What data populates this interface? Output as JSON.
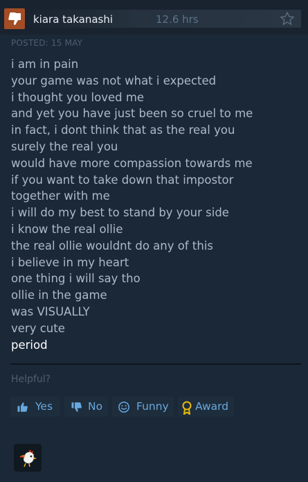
{
  "review": {
    "username": "kiara takanashi",
    "hours": "12.6 hrs",
    "posted": "POSTED: 15 MAY",
    "recommended": false,
    "lines": [
      "i am in pain",
      "your game was not what i expected",
      "i thought you loved me",
      "and yet you have just been so cruel to me",
      "in fact, i dont think that as the real you",
      "surely the real you",
      "would have more compassion towards me",
      "if you want to take down that impostor",
      "together with me",
      "i will do my best to stand by your side",
      "i know the real ollie",
      "the real ollie wouldnt do any of this",
      "i believe in my heart",
      "one thing i will say tho",
      "ollie in the game",
      "was VISUALLY",
      "very cute",
      "period"
    ]
  },
  "feedback": {
    "helpful_label": "Helpful?",
    "yes_label": "Yes",
    "no_label": "No",
    "funny_label": "Funny",
    "award_label": "Award"
  },
  "icons": {
    "recommend": "thumbs-down-icon",
    "favorite": "star-icon",
    "yes": "thumbs-up-icon",
    "no": "thumbs-down-icon",
    "funny": "smiley-icon",
    "award": "award-ribbon-icon",
    "reaction": "phoenix-emoji-icon"
  },
  "colors": {
    "background": "#1b2838",
    "thumb_bg": "#a34c25",
    "text": "#acb9c8",
    "link": "#68a8df",
    "award": "#e8b90c"
  }
}
